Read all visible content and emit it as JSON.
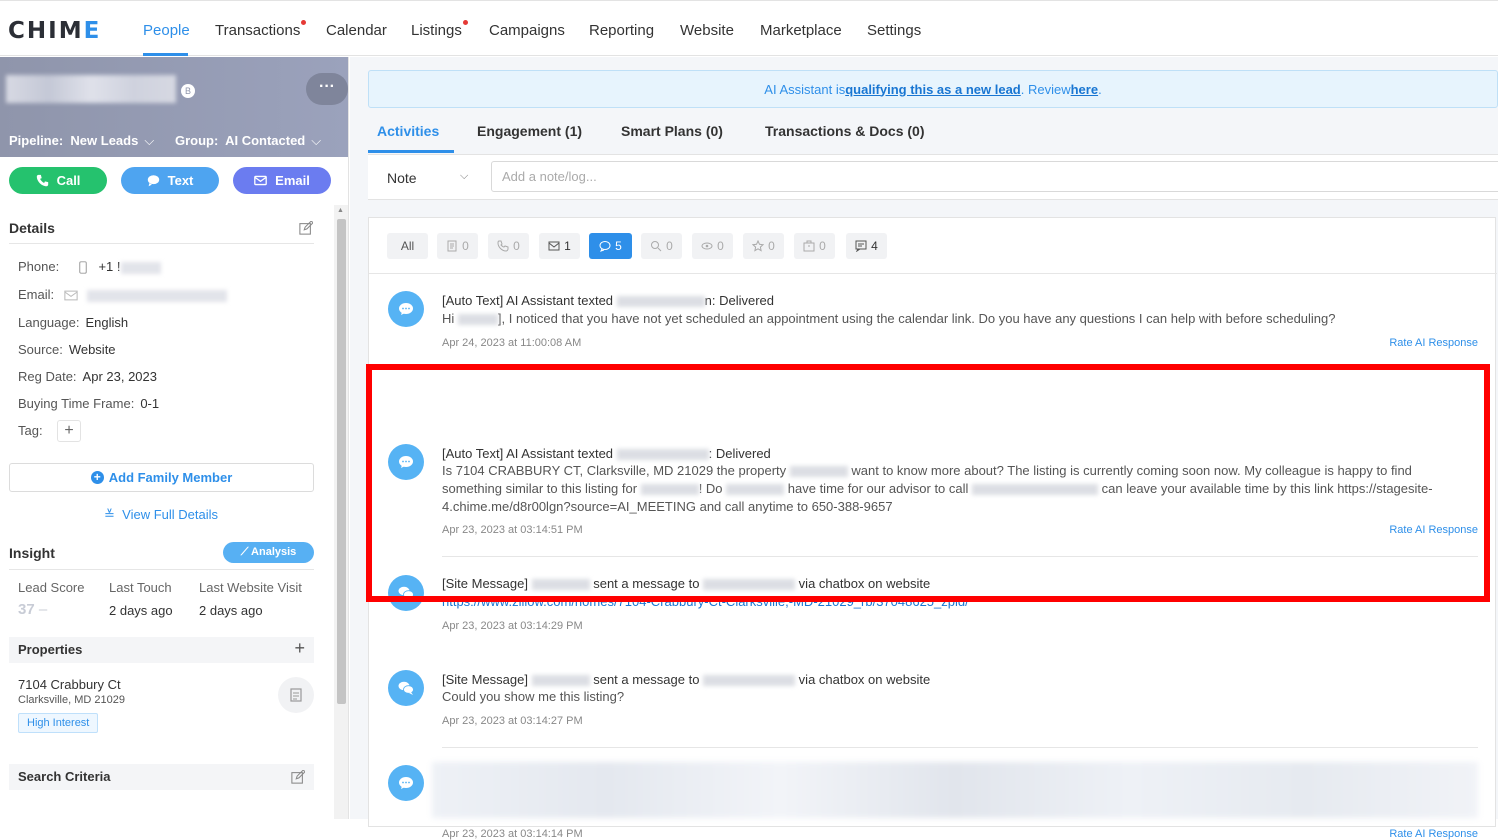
{
  "brand": {
    "logo_text_a": "CHI",
    "logo_text_b": "M",
    "logo_text_c": "E",
    "accent": "#2e8fe9"
  },
  "nav": {
    "items": [
      {
        "label": "People",
        "active": true
      },
      {
        "label": "Transactions",
        "dot": true
      },
      {
        "label": "Calendar"
      },
      {
        "label": "Listings",
        "dot": true
      },
      {
        "label": "Campaigns"
      },
      {
        "label": "Reporting"
      },
      {
        "label": "Website"
      },
      {
        "label": "Marketplace"
      },
      {
        "label": "Settings"
      }
    ]
  },
  "lead": {
    "badge": "B",
    "more": "···",
    "pipeline_label": "Pipeline:",
    "pipeline_value": "New Leads",
    "group_label": "Group:",
    "group_value": "AI Contacted",
    "call": "Call",
    "text": "Text",
    "email": "Email"
  },
  "details": {
    "title": "Details",
    "phone_label": "Phone:",
    "phone_value": "+1 !",
    "email_label": "Email:",
    "language_label": "Language:",
    "language_value": "English",
    "source_label": "Source:",
    "source_value": "Website",
    "reg_label": "Reg Date:",
    "reg_value": "Apr 23, 2023",
    "buying_label": "Buying Time Frame:",
    "buying_value": "0-1",
    "tag_label": "Tag:",
    "add_family": "Add Family Member",
    "view_full": "View Full Details"
  },
  "insight": {
    "title": "Insight",
    "analysis": "Analysis",
    "lead_score_label": "Lead Score",
    "lead_score_value": "37",
    "last_touch_label": "Last Touch",
    "last_touch_value": "2 days ago",
    "last_visit_label": "Last Website Visit",
    "last_visit_value": "2 days ago"
  },
  "properties": {
    "title": "Properties",
    "address": "7104 Crabbury Ct",
    "city": "Clarksville, MD 21029",
    "tag": "High Interest"
  },
  "search_criteria": {
    "title": "Search Criteria"
  },
  "banner": {
    "pre": "AI Assistant is ",
    "link1": "qualifying this as a new lead",
    "mid": ". Review ",
    "link2": "here",
    "post": "."
  },
  "tabs": [
    {
      "label": "Activities",
      "active": true
    },
    {
      "label": "Engagement (1)"
    },
    {
      "label": "Smart Plans (0)"
    },
    {
      "label": "Transactions & Docs (0)"
    }
  ],
  "composer": {
    "type": "Note",
    "placeholder": "Add a note/log..."
  },
  "filters": [
    {
      "label": "All"
    },
    {
      "icon": "document-icon",
      "count": "0"
    },
    {
      "icon": "phone-icon",
      "count": "0"
    },
    {
      "icon": "mail-icon",
      "count": "1"
    },
    {
      "icon": "chat-icon",
      "count": "5",
      "active": true
    },
    {
      "icon": "search-icon",
      "count": "0"
    },
    {
      "icon": "eye-icon",
      "count": "0"
    },
    {
      "icon": "star-icon",
      "count": "0"
    },
    {
      "icon": "briefcase-icon",
      "count": "0"
    },
    {
      "icon": "note-icon",
      "count": "4"
    }
  ],
  "activities": [
    {
      "title_pre": "[Auto Text] AI Assistant texted ",
      "title_post": "n: Delivered",
      "body_pre": "Hi ",
      "body_post": "], I noticed that you have not yet scheduled an appointment using the calendar link. Do you have any questions I can help with before scheduling?",
      "date": "Apr 24, 2023 at 11:00:08 AM",
      "rate": "Rate AI Response"
    },
    {
      "title_pre": "[Auto Text] AI Assistant texted ",
      "title_post": ": Delivered",
      "body_line1_pre": "Is 7104 CRABBURY CT, Clarksville, MD 21029 the property ",
      "body_line1_post": " want to know more about? The listing is currently coming soon now. My colleague is happy to find",
      "body_line2_pre": "something similar to this listing for ",
      "body_line2_mid": "! Do ",
      "body_line2_mid2": " have time for our advisor to call ",
      "body_line2_post": " can leave your available time by this link https://stagesite-",
      "body_line3": "4.chime.me/d8r00lgn?source=AI_MEETING and call anytime to 650-388-9657",
      "date": "Apr 23, 2023 at 03:14:51 PM",
      "rate": "Rate AI Response"
    },
    {
      "title_pre": "[Site Message] ",
      "title_mid": " sent a message to ",
      "title_post": " via chatbox on website",
      "link": "https://www.zillow.com/homes/7104-Crabbury-Ct-Clarksville,-MD-21029_rb/37048625_zpid/",
      "date": "Apr 23, 2023 at 03:14:29 PM"
    },
    {
      "title_pre": "[Site Message] ",
      "title_mid": " sent a message to ",
      "title_post": " via chatbox on website",
      "body": "Could you show me this listing?",
      "date": "Apr 23, 2023 at 03:14:27 PM"
    },
    {
      "date": "Apr 23, 2023 at 03:14:14 PM",
      "rate": "Rate AI Response"
    }
  ]
}
